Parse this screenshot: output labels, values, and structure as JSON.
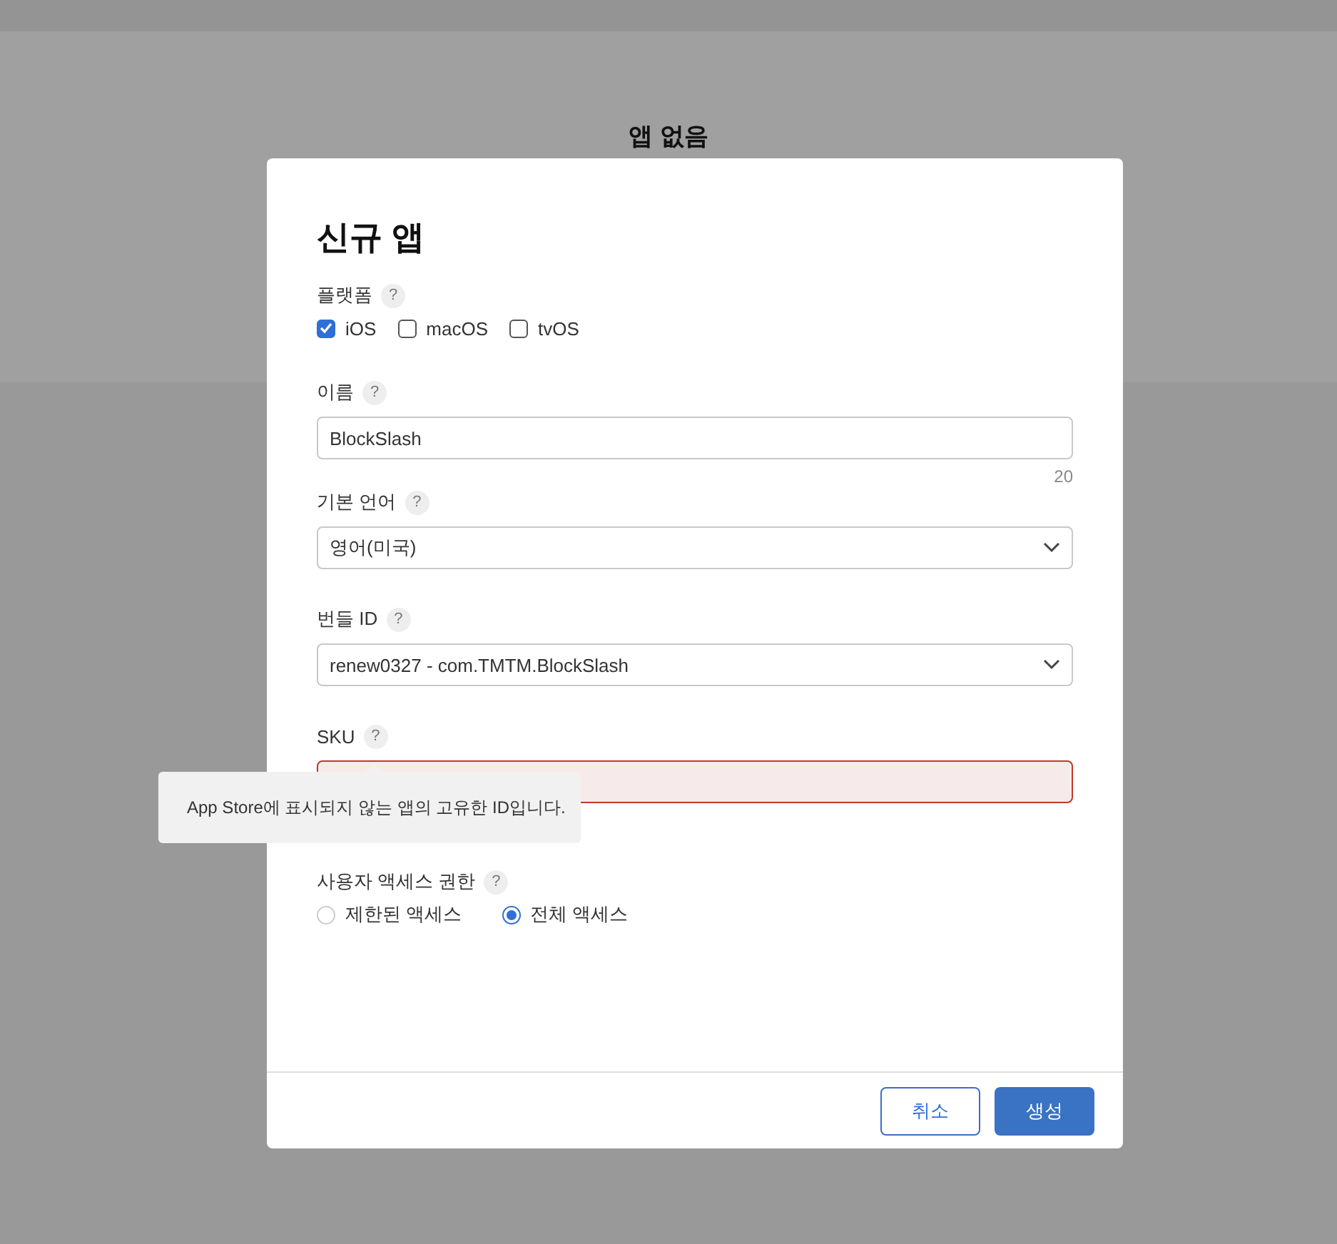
{
  "background": {
    "heading": "앱 없음"
  },
  "dialog": {
    "title": "신규 앱",
    "platform": {
      "label": "플랫폼",
      "help": "?",
      "options": [
        {
          "label": "iOS",
          "checked": true
        },
        {
          "label": "macOS",
          "checked": false
        },
        {
          "label": "tvOS",
          "checked": false
        }
      ]
    },
    "name": {
      "label": "이름",
      "help": "?",
      "value": "BlockSlash",
      "counter": "20"
    },
    "language": {
      "label": "기본 언어",
      "help": "?",
      "value": "영어(미국)"
    },
    "bundle_id": {
      "label": "번들 ID",
      "help": "?",
      "value": "renew0327 - com.TMTM.BlockSlash"
    },
    "sku": {
      "label": "SKU",
      "help": "?",
      "invalid": true,
      "tooltip": "App Store에 표시되지 않는 앱의 고유한 ID입니다."
    },
    "user_access": {
      "label": "사용자 액세스 권한",
      "help": "?",
      "options": [
        {
          "label": "제한된 액세스",
          "selected": false
        },
        {
          "label": "전체 액세스",
          "selected": true
        }
      ]
    },
    "buttons": [
      {
        "label": "취소",
        "kind": "secondary"
      },
      {
        "label": "생성",
        "kind": "primary"
      }
    ]
  }
}
